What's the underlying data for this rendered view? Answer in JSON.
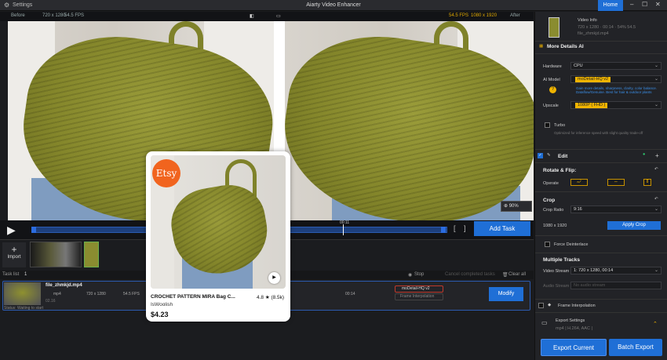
{
  "titlebar": {
    "settings": "Settings",
    "title": "Aiarty Video Enhancer",
    "home": "Home"
  },
  "compare": {
    "before": "Before",
    "before_res": "720 x 1280",
    "before_fps": "54.5 FPS",
    "after_fps": "54.5 FPS",
    "after_res": "1080 x 1920",
    "after": "After"
  },
  "video": {
    "zoom": "90%"
  },
  "playback": {
    "time": "00:11",
    "add_task": "Add Task"
  },
  "media": {
    "import": "Import"
  },
  "tasklist": {
    "label": "Task list",
    "count": "1",
    "stop": "Stop",
    "cancel_completed": "Cancel completed tasks",
    "clear_all": "Clear all",
    "task": {
      "name": "file_zhmkjd.mp4",
      "format": "mp4",
      "res_in": "720 x 1280",
      "fps": "54.5 FPS",
      "time_a": "00:14",
      "time_b": "00:14",
      "size": "02.16",
      "model": "moDetail-HQ  v2",
      "interp": "Frame Interpolation",
      "modify": "Modify",
      "status": "Status: Waiting to start"
    }
  },
  "panel": {
    "video_info": "Video Info",
    "video_info_line1": "720 x 1280  · 00:14 · 54% 54.5",
    "video_info_line2": "file_zhmkjd.mp4",
    "more_details": "More Details AI",
    "hardware_label": "Hardware",
    "hardware": "CPU",
    "ai_model_label": "AI Model",
    "ai_model": "moDetail-HQ  v2",
    "ai_model_desc": "Gain more details, sharpness, clarity, color balance. Dataflow/Genuine. Best for hair & outdoor plants",
    "upscale_label": "Upscale",
    "upscale": "1080P  ( FHD )",
    "turbo": "Turbo",
    "turbo_desc": "Optimized for inference speed with slight quality trade-off",
    "edit": "Edit",
    "rotate_flip": "Rotate & Flip:",
    "operate": "Operate",
    "crop": "Crop",
    "crop_ratio_label": "Crop Ratio",
    "crop_ratio": "9:16",
    "crop_res": "1080 x 1920",
    "apply_crop": "Apply Crop",
    "force_deinterlace": "Force Deinterlace",
    "multiple_tracks": "Multiple Tracks",
    "video_stream_label": "Video Stream",
    "video_stream": "1: 720 x 1280, 00:14",
    "audio_stream_label": "Audio Stream",
    "audio_stream": "No audio stream",
    "frame_interp": "Frame Interpolation",
    "export_settings": "Export Settings",
    "export_sub": "mp4 | H.264, AAC |",
    "export_current": "Export Current",
    "batch_export": "Batch Export"
  },
  "card": {
    "logo": "Etsy",
    "title": "CROCHET PATTERN MIRA Bag C...",
    "rating": "4.8 ★ (8.5k)",
    "shop": "IsWoolish",
    "price": "$4.23"
  }
}
